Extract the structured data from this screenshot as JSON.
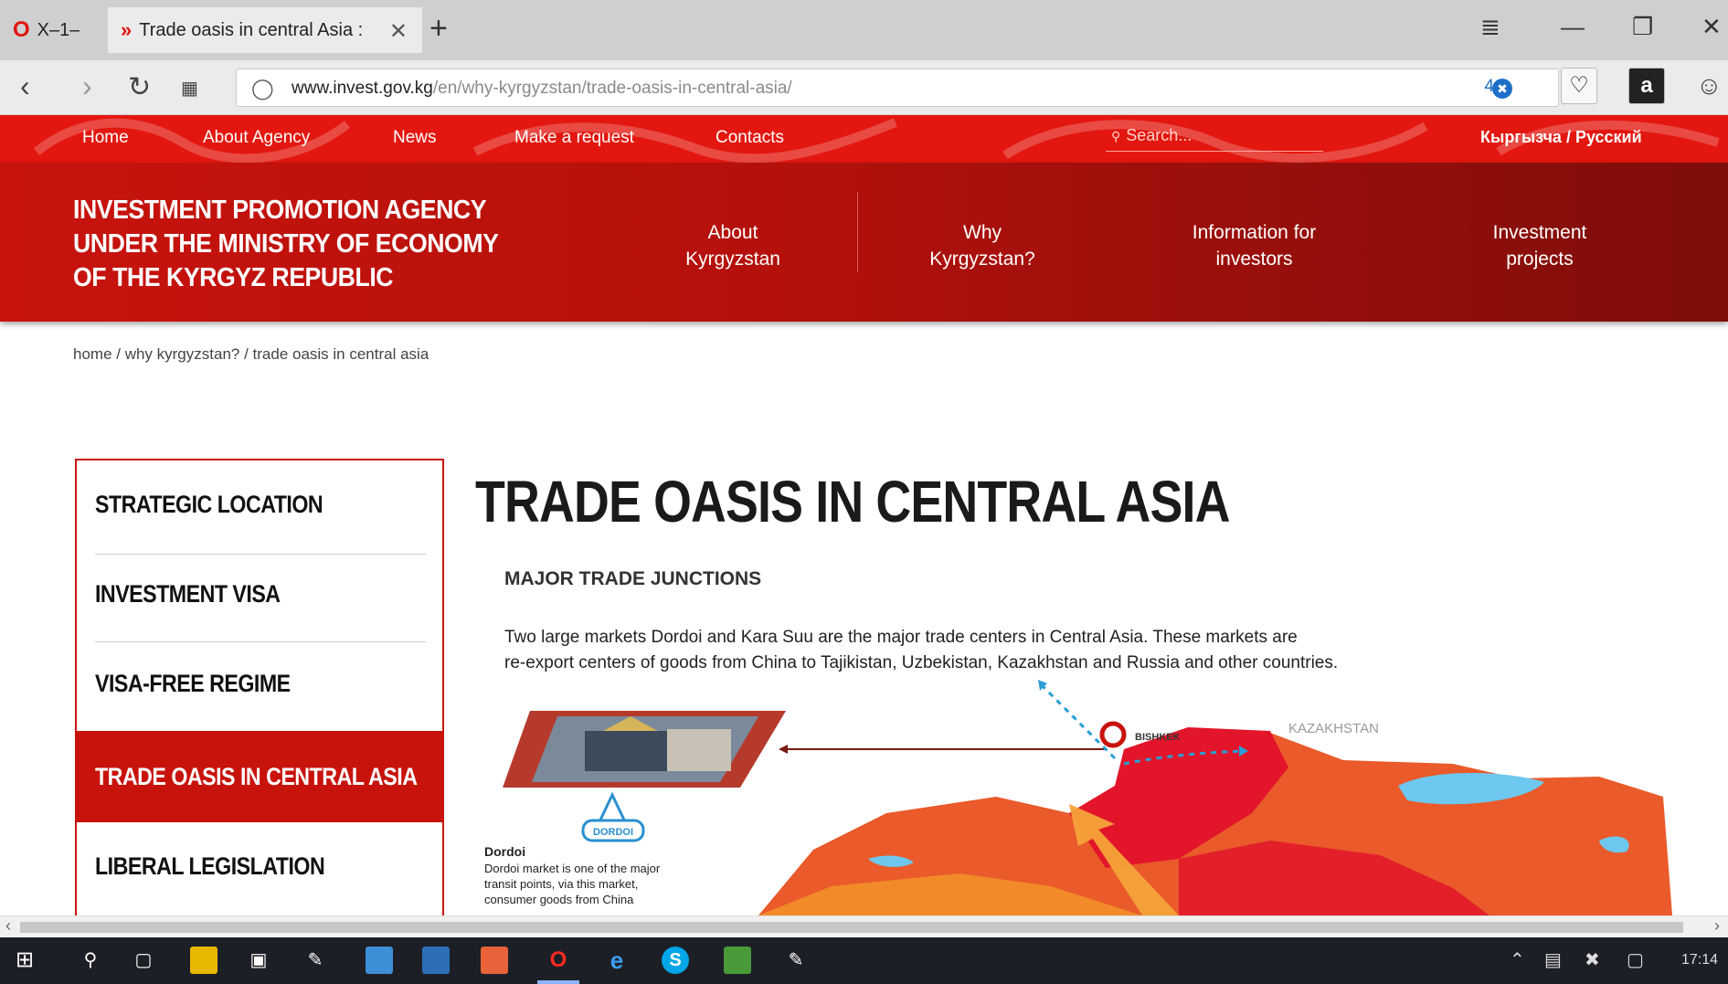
{
  "browser": {
    "tabs": [
      {
        "label": "Х–1–",
        "active": false
      },
      {
        "label": "Trade oasis in central Asia :",
        "active": true
      }
    ],
    "new_tab": "+",
    "window_controls": [
      "≣",
      "—",
      "❐",
      "✕"
    ],
    "url_host": "www.invest.gov.kg",
    "url_path": "/en/why-kyrgyzstan/trade-oasis-in-central-asia/",
    "shield_count": "4",
    "amazon": "a"
  },
  "site": {
    "topnav": [
      "Home",
      "About Agency",
      "News",
      "Make a request",
      "Contacts"
    ],
    "search_placeholder": "Search...",
    "language": "Кыргызча / Русский",
    "agency_line1": "INVESTMENT PROMOTION AGENCY",
    "agency_line2": "UNDER THE MINISTRY OF ECONOMY",
    "agency_line3": "OF THE KYRGYZ REPUBLIC",
    "mainnav": [
      {
        "line1": "About",
        "line2": "Kyrgyzstan"
      },
      {
        "line1": "Why",
        "line2": "Kyrgyzstan?"
      },
      {
        "line1": "Information for",
        "line2": "investors"
      },
      {
        "line1": "Investment",
        "line2": "projects"
      }
    ],
    "breadcrumb": "home / why kyrgyzstan? / trade oasis in central asia"
  },
  "sidebar": {
    "items": [
      {
        "label": "STRATEGIC LOCATION",
        "active": false
      },
      {
        "label": "INVESTMENT VISA",
        "active": false
      },
      {
        "label": "VISA-FREE REGIME",
        "active": false
      },
      {
        "label": "TRADE OASIS IN CENTRAL ASIA",
        "active": true
      },
      {
        "label": "LIBERAL LEGISLATION",
        "active": false
      }
    ]
  },
  "content": {
    "title": "TRADE OASIS IN CENTRAL ASIA",
    "section_heading": "MAJOR TRADE JUNCTIONS",
    "body_line1": "Two large markets Dordoi and Kara Suu are the major trade centers in Central Asia. These markets are",
    "body_line2": "re-export centers of goods from China to Tajikistan, Uzbekistan, Kazakhstan and Russia and other countries.",
    "map_labels": {
      "bishkek": "BISHKEK",
      "kazakhstan": "KAZAKHSTAN",
      "dordoi_logo": "DORDOI"
    },
    "dordoi_heading": "Dordoi",
    "dordoi_line1": "Dordoi market is one of the major",
    "dordoi_line2": "transit points, via this market,",
    "dordoi_line3": "consumer goods from China"
  },
  "taskbar": {
    "clock": "17:14"
  },
  "colors": {
    "brand_red": "#e3170f",
    "header_red": "#b4110c",
    "accent_blue": "#1e6fc9"
  }
}
